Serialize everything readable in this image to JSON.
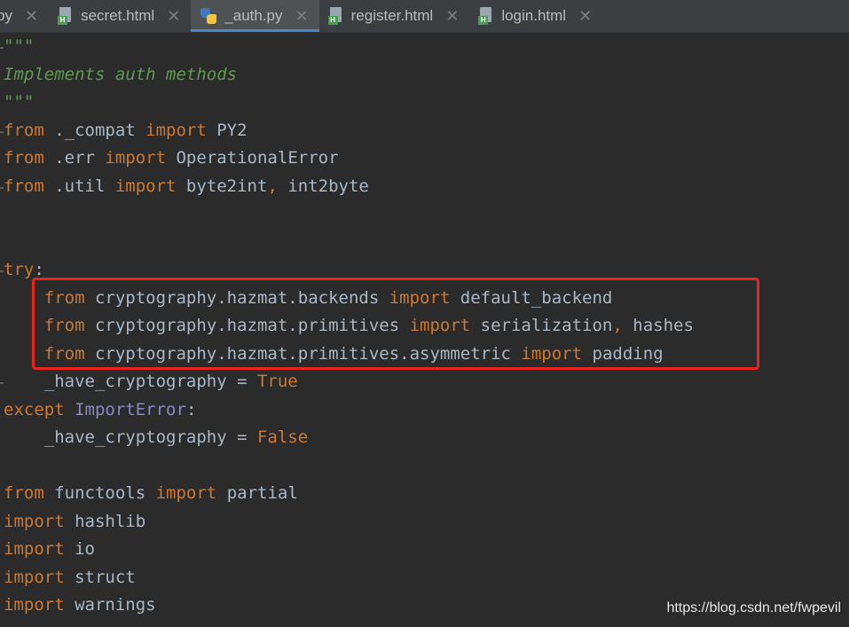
{
  "tabs": [
    {
      "label": "py",
      "icon": "none",
      "active": false
    },
    {
      "label": "secret.html",
      "icon": "html-file-icon",
      "active": false
    },
    {
      "label": "_auth.py",
      "icon": "python-file-icon",
      "active": true
    },
    {
      "label": "register.html",
      "icon": "html-file-icon",
      "active": false
    },
    {
      "label": "login.html",
      "icon": "html-file-icon",
      "active": false
    }
  ],
  "tab_close_glyph": "✕",
  "code_lines": [
    [
      {
        "t": "\"\"\"",
        "c": "doc-str"
      }
    ],
    [
      {
        "t": "Implements auth methods",
        "c": "doc-str"
      }
    ],
    [
      {
        "t": "\"\"\"",
        "c": "doc-str"
      }
    ],
    [
      {
        "t": "from",
        "c": "kw"
      },
      {
        "t": " ._compat ",
        "c": ""
      },
      {
        "t": "import",
        "c": "kw"
      },
      {
        "t": " PY2",
        "c": ""
      }
    ],
    [
      {
        "t": "from",
        "c": "kw"
      },
      {
        "t": " .err ",
        "c": ""
      },
      {
        "t": "import",
        "c": "kw"
      },
      {
        "t": " OperationalError",
        "c": ""
      }
    ],
    [
      {
        "t": "from",
        "c": "kw"
      },
      {
        "t": " .util ",
        "c": ""
      },
      {
        "t": "import",
        "c": "kw"
      },
      {
        "t": " byte2int",
        "c": ""
      },
      {
        "t": ",",
        "c": "kw"
      },
      {
        "t": " int2byte",
        "c": ""
      }
    ],
    [],
    [],
    [
      {
        "t": "try",
        "c": "kw"
      },
      {
        "t": ":",
        "c": ""
      }
    ],
    [
      {
        "t": "    ",
        "c": ""
      },
      {
        "t": "from",
        "c": "kw"
      },
      {
        "t": " cryptography.hazmat.backends ",
        "c": ""
      },
      {
        "t": "import",
        "c": "kw"
      },
      {
        "t": " default_backend",
        "c": ""
      }
    ],
    [
      {
        "t": "    ",
        "c": ""
      },
      {
        "t": "from",
        "c": "kw"
      },
      {
        "t": " cryptography.hazmat.primitives ",
        "c": ""
      },
      {
        "t": "import",
        "c": "kw"
      },
      {
        "t": " serialization",
        "c": ""
      },
      {
        "t": ",",
        "c": "kw"
      },
      {
        "t": " hashes",
        "c": ""
      }
    ],
    [
      {
        "t": "    ",
        "c": ""
      },
      {
        "t": "from",
        "c": "kw"
      },
      {
        "t": " cryptography.hazmat.primitives.asymmetric ",
        "c": ""
      },
      {
        "t": "import",
        "c": "kw"
      },
      {
        "t": " padding",
        "c": ""
      }
    ],
    [
      {
        "t": "    _have_cryptography = ",
        "c": ""
      },
      {
        "t": "True",
        "c": "kw"
      }
    ],
    [
      {
        "t": "except",
        "c": "kw"
      },
      {
        "t": " ",
        "c": ""
      },
      {
        "t": "ImportError",
        "c": "cls"
      },
      {
        "t": ":",
        "c": ""
      }
    ],
    [
      {
        "t": "    _have_cryptography = ",
        "c": ""
      },
      {
        "t": "False",
        "c": "kw"
      }
    ],
    [],
    [
      {
        "t": "from",
        "c": "kw"
      },
      {
        "t": " functools ",
        "c": ""
      },
      {
        "t": "import",
        "c": "kw"
      },
      {
        "t": " partial",
        "c": ""
      }
    ],
    [
      {
        "t": "import",
        "c": "kw"
      },
      {
        "t": " hashlib",
        "c": ""
      }
    ],
    [
      {
        "t": "import",
        "c": "kw"
      },
      {
        "t": " io",
        "c": ""
      }
    ],
    [
      {
        "t": "import",
        "c": "kw"
      },
      {
        "t": " struct",
        "c": ""
      }
    ],
    [
      {
        "t": "import",
        "c": "kw"
      },
      {
        "t": " warnings",
        "c": ""
      }
    ]
  ],
  "watermark": "https://blog.csdn.net/fwpevil",
  "colors": {
    "background": "#2b2b2b",
    "keyword": "#cc7832",
    "docstring": "#629755",
    "text": "#a9b7c6",
    "builtin_class": "#8888c6",
    "highlight_box": "#e8241f",
    "active_tab_underline": "#4a88c7"
  }
}
